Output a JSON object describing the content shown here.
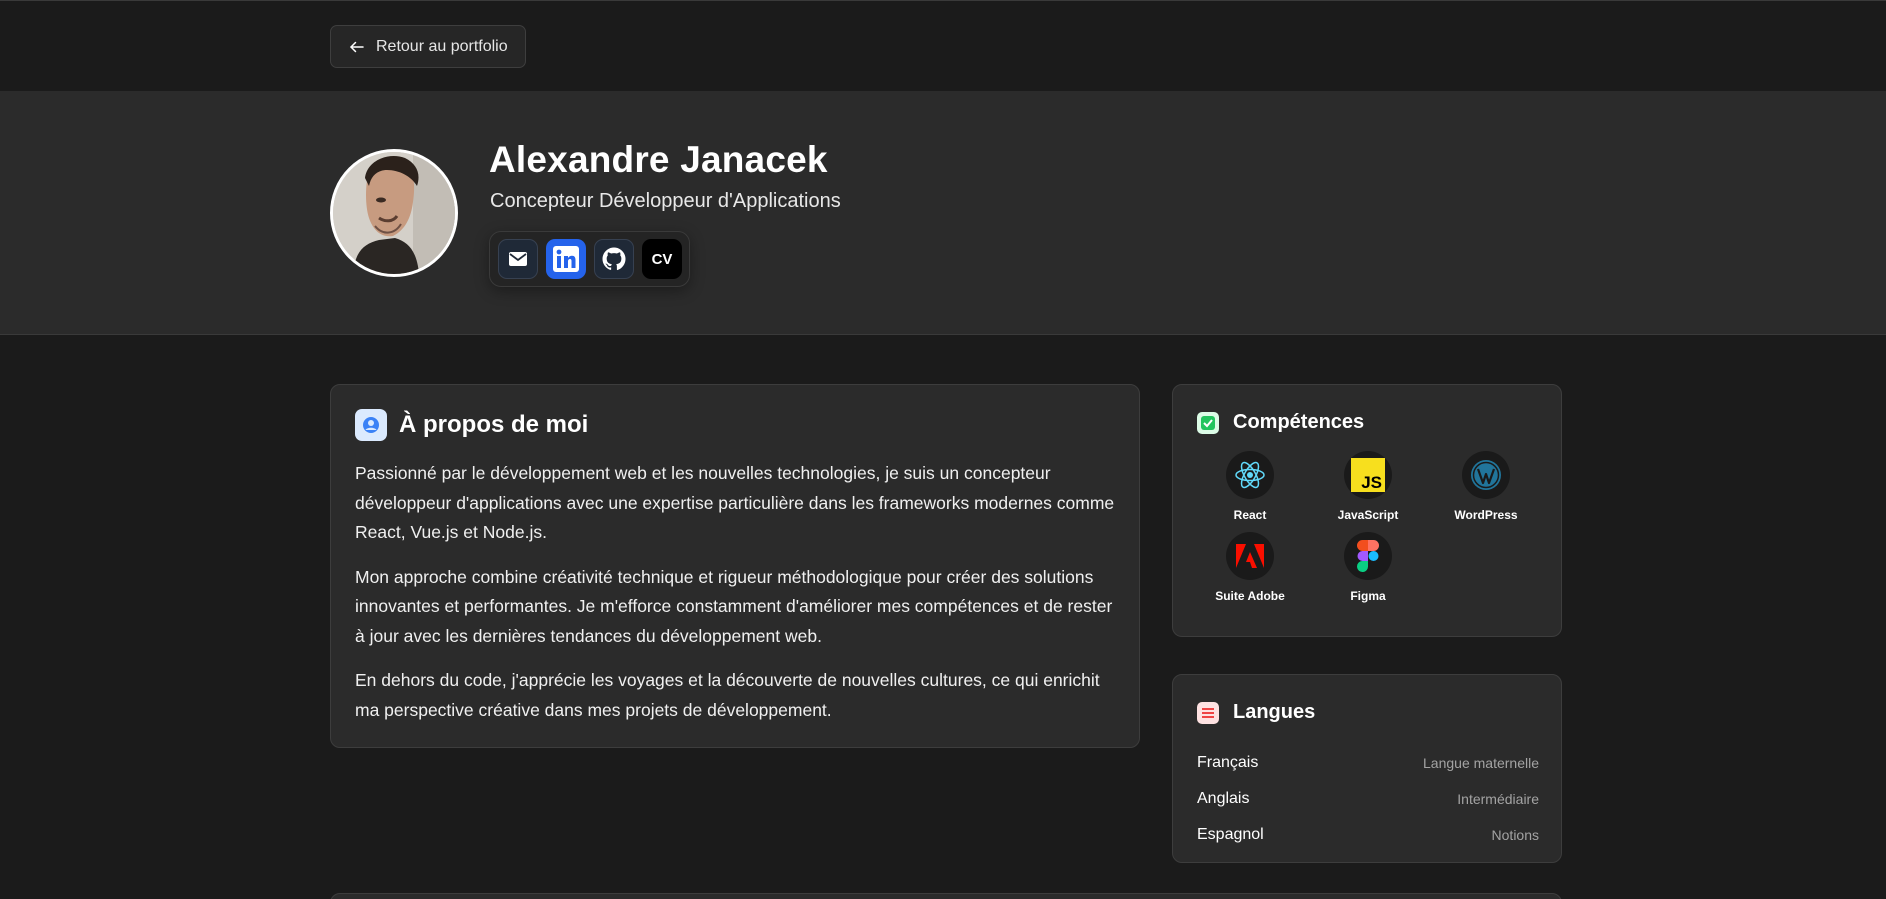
{
  "nav": {
    "back_label": "Retour au portfolio"
  },
  "profile": {
    "name": "Alexandre Janacek",
    "role": "Concepteur Développeur d'Applications",
    "avatar_icon": "portrait-photo",
    "socials": [
      {
        "icon": "mail-icon",
        "label": ""
      },
      {
        "icon": "linkedin-icon",
        "label": ""
      },
      {
        "icon": "github-icon",
        "label": ""
      },
      {
        "icon": "cv-icon",
        "label": "CV"
      }
    ]
  },
  "about": {
    "title": "À propos de moi",
    "paragraphs": [
      "Passionné par le développement web et les nouvelles technologies, je suis un concepteur développeur d'applications avec une expertise particulière dans les frameworks modernes comme React, Vue.js et Node.js.",
      "Mon approche combine créativité technique et rigueur méthodologique pour créer des solutions innovantes et performantes. Je m'efforce constamment d'améliorer mes compétences et de rester à jour avec les dernières tendances du développement web.",
      "En dehors du code, j'apprécie les voyages et la découverte de nouvelles cultures, ce qui enrichit ma perspective créative dans mes projets de développement."
    ]
  },
  "skills": {
    "title": "Compétences",
    "items": [
      {
        "label": "React",
        "icon": "react-icon"
      },
      {
        "label": "JavaScript",
        "icon": "javascript-icon"
      },
      {
        "label": "WordPress",
        "icon": "wordpress-icon"
      },
      {
        "label": "Suite Adobe",
        "icon": "adobe-icon"
      },
      {
        "label": "Figma",
        "icon": "figma-icon"
      }
    ]
  },
  "languages": {
    "title": "Langues",
    "items": [
      {
        "name": "Français",
        "level": "Langue maternelle"
      },
      {
        "name": "Anglais",
        "level": "Intermédiaire"
      },
      {
        "name": "Espagnol",
        "level": "Notions"
      }
    ]
  },
  "colors": {
    "background": "#1b1b1b",
    "card": "#2b2b2b",
    "linkedin": "#2563eb",
    "accent_about": "#3b82f6",
    "accent_skills": "#22c55e",
    "accent_langs": "#ef4444"
  }
}
